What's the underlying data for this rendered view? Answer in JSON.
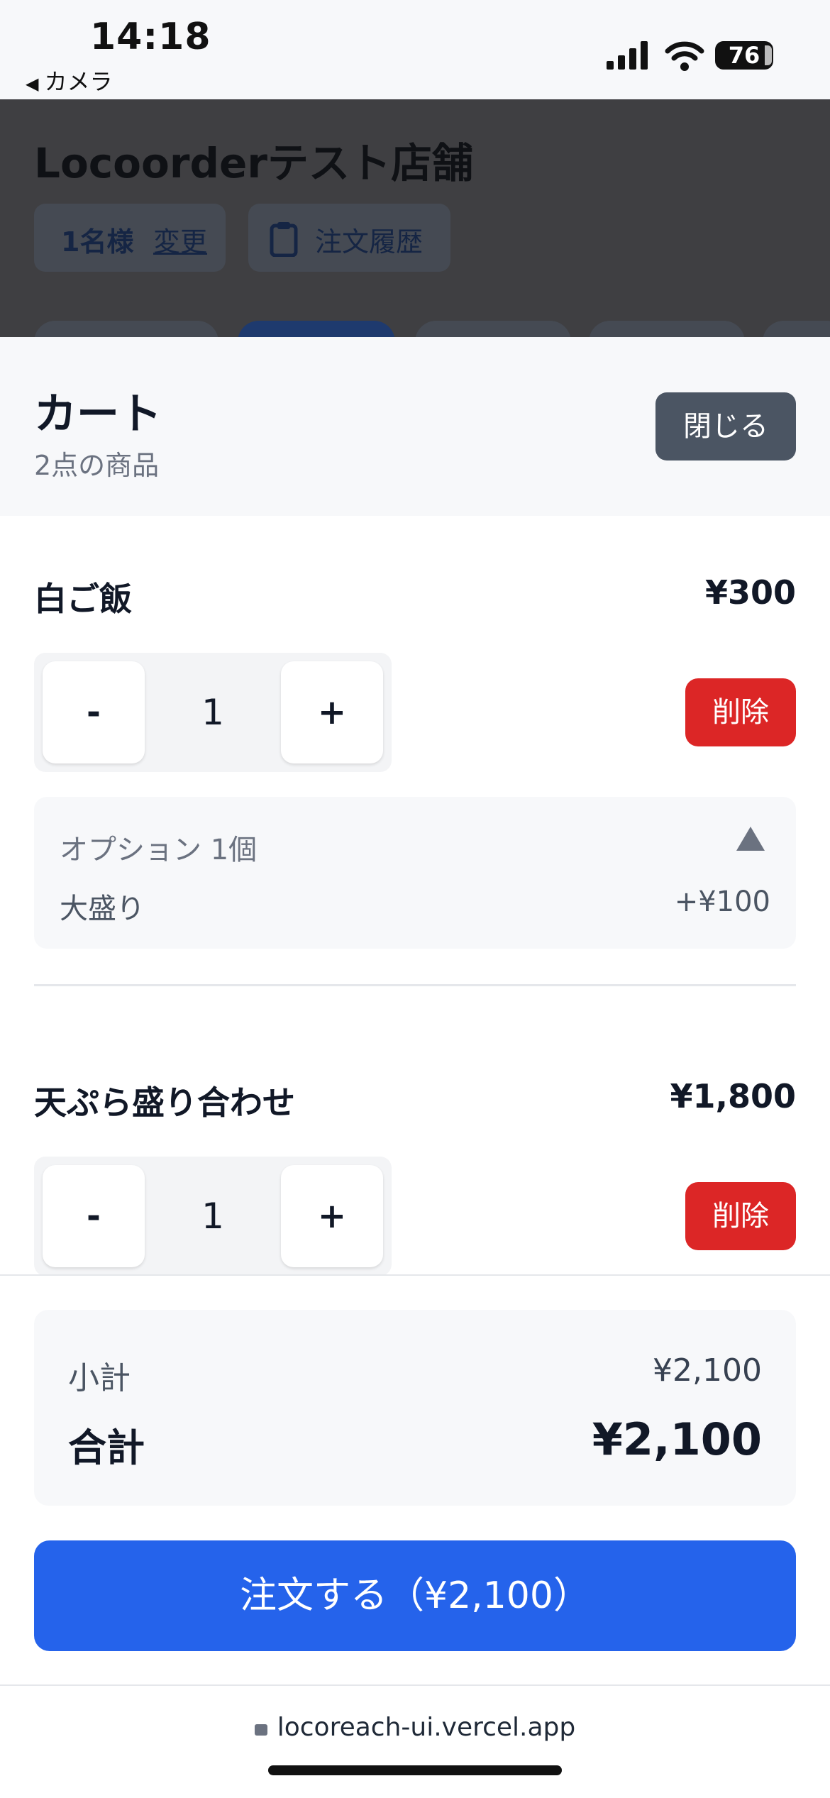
{
  "status_bar": {
    "time": "14:18",
    "back_label": "カメラ",
    "battery": "76"
  },
  "background_page": {
    "store_name": "Locoorderテスト店舗",
    "guest_count": "1名様",
    "change_link": "変更",
    "history_label": "注文履歴"
  },
  "cart": {
    "title": "カート",
    "item_count": "2点の商品",
    "close_label": "閉じる",
    "items": [
      {
        "name": "白ご飯",
        "price": "¥300",
        "quantity": "1",
        "minus_label": "-",
        "plus_label": "+",
        "delete_label": "削除",
        "options_label": "オプション 1個",
        "options": [
          {
            "name": "大盛り",
            "price": "+¥100"
          }
        ]
      },
      {
        "name": "天ぷら盛り合わせ",
        "price": "¥1,800",
        "quantity": "1",
        "minus_label": "-",
        "plus_label": "+",
        "delete_label": "削除"
      }
    ]
  },
  "summary": {
    "subtotal_label": "小計",
    "subtotal_value": "¥2,100",
    "total_label": "合計",
    "total_value": "¥2,100"
  },
  "order_button_label": "注文する（¥2,100）",
  "browser": {
    "url": "locoreach-ui.vercel.app"
  },
  "colors": {
    "primary": "#2563eb",
    "danger": "#dc2626",
    "overlay": "#3f3f42"
  }
}
